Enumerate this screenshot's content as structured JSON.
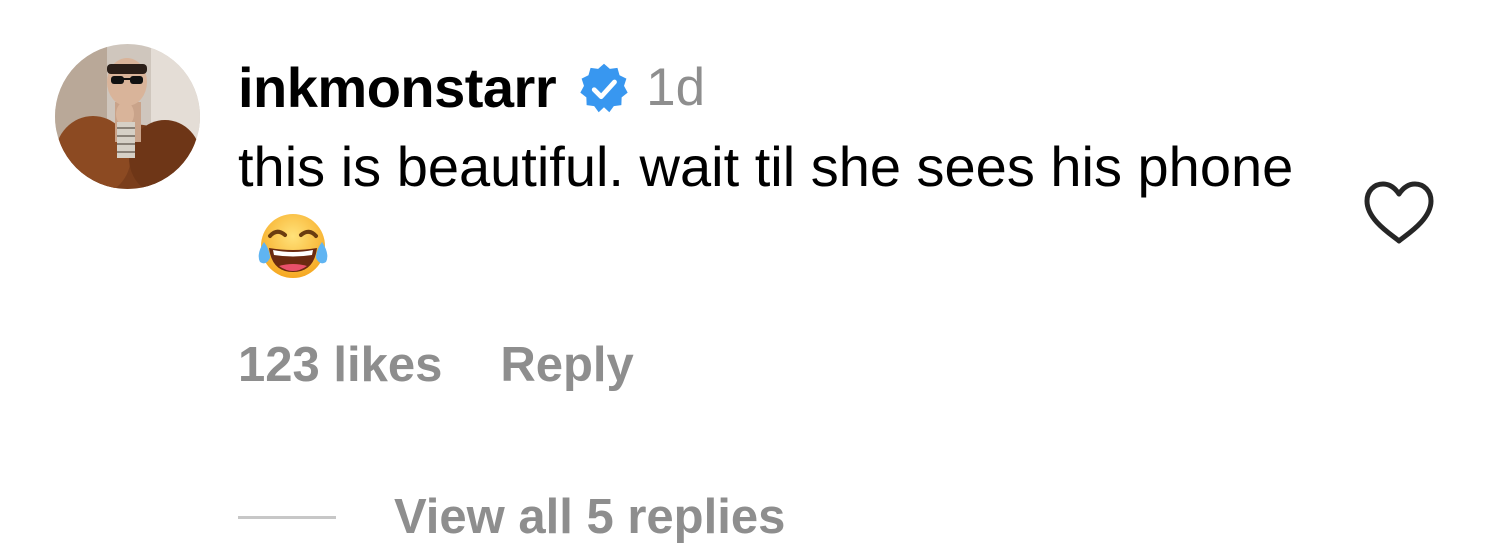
{
  "comment": {
    "avatar_icon": "user-avatar",
    "username": "inkmonstarr",
    "verified_icon": "verified-badge-icon",
    "verified_color": "#3897f0",
    "timestamp": "1d",
    "text": "this is beautiful. wait til she sees his phone",
    "emoji_icon": "face-with-tears-of-joy-emoji",
    "like_icon": "heart-outline-icon",
    "likes_label": "123 likes",
    "reply_label": "Reply",
    "view_replies_label": "View all 5 replies"
  },
  "colors": {
    "text_primary": "#000000",
    "text_secondary": "#8e8e8e",
    "divider": "#c7c7c7"
  }
}
